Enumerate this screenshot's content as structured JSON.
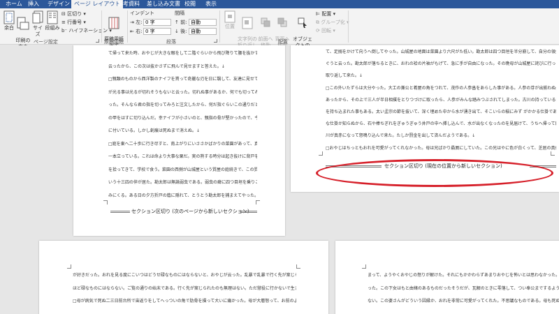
{
  "tabs": [
    "ホーム",
    "挿入",
    "デザイン",
    "ページ レイアウト",
    "参考資料",
    "差し込み文書",
    "校閲",
    "表示"
  ],
  "ribbon": {
    "page_setup": {
      "margins": "余白",
      "orientation": "印刷の\n向き",
      "size": "サイズ",
      "columns": "段組み",
      "breaks": "区切り",
      "line_numbers": "行番号",
      "hyphenation": "ハイフネーション",
      "group_label": "ページ設定"
    },
    "manuscript": {
      "button": "原稿用紙\n設定",
      "group_label": "原稿用紙"
    },
    "paragraph": {
      "indent_heading": "インデント",
      "spacing_heading": "間隔",
      "left_label": "左:",
      "right_label": "右:",
      "left_value": "0 字",
      "right_value": "0 字",
      "before_label": "前:",
      "after_label": "後:",
      "before_value": "自動",
      "after_value": "自動",
      "group_label": "段落"
    },
    "arrange": {
      "position": "位置",
      "wrap_text": "文字列の\n折り返し",
      "bring_forward": "前面へ\n移動",
      "send_backward": "背面へ\n移動",
      "selection_pane": "オブジェクトの\n選択と表示",
      "align": "配置",
      "group": "グループ化",
      "rotate": "回転",
      "group_label": "配置"
    }
  },
  "pages": {
    "left_top_lines": [
      "て帰って来た時、おやじが大きな眼をして二階ぐらいから飛び降りて腰を抜かす奴があるかと",
      "云ったから、この次は抜かさずに飛んで見せますと答えた。↓",
      "□親類のものから西洋製のナイフを貰って奇麗な刃を日に翳して、友達に見せていたら、一人",
      "が光る事は光るが切れそうもないと云った。切れぬ事があるか、何でも切ってみせると受け合",
      "った。そんなら君の指を切ってみろと注文したから、何だ指ぐらいこの通りだと右の手の親指",
      "の甲をはすに切り込んだ。幸ナイフが小さいのと、親指の骨が堅かったので、今だに親指は手",
      "に付いている。しかし創痕は死ぬまで消えぬ。↓",
      "□庭を東へ二十歩に行き尽すと、南上がりにいささかばかりの菜園があって、真中に栗の木が",
      "一本立っている。これは命より大事な栗だ。実の熟する時分は起き抜けに背戸を出て落ちた奴",
      "を拾ってきて、学校で食う。菜園の西側が山城屋という質屋の庭続きで、この質屋に勘太郎と",
      "いう十三四の倅が居た。勘太郎は無論弱虫である。弱虫の癖に四つ目垣を乗りこえて、栗を盗",
      "みにくる。ある日の夕方折戸の蔭に隠れて、とうとう勘太郎を捕まえてやった。その時勘太郎"
    ],
    "left_section_break": "セクション区切り (次のページから新しいセクション)",
    "right_top_lines": [
      "て、足搦をかけて向うへ倒してやった。山城屋の地面は菜園より六尺がた低い。勘太郎は四つ目垣を半分崩して、自分の領分へ真逆様に落ちて",
      "ぐうと云った。勘太郎が落ちるときに、おれの袷の片袖がもげて、急に手が自由になった。その晩母が山城屋に詫びに行ったついでに袷の片袖も",
      "取り返して来た。↓",
      "□この外いたずらは大分やった。大工の兼公と肴屋の角をつれて、茂作の人参畠をあらした事がある。人参の芽が出揃わぬ処へ藁が一面に敷いて",
      "あったから、その上で三人が半日相撲をとりつづけに取ったら、人参がみんな踏みつぶされてしまった。古川の持っている田圃の井戸を埋めて尻",
      "を持ち込まれた事もある。太い孟宗の節を抜いて、深く埋めた中から水が湧き出て、そこいらの稲にみず がかかる仕掛であった。その時分はどん",
      "な仕掛か知らぬから、石や棒ちぎれをぎゅうぎゅう井戸の中へ挿し込んで、水が出なくなったのを見届けて、うちへ帰って飯を食っていたら、古",
      "川が真赤になって怒鳴り込んで来た。たしか罰金を出して済んだようである。↓",
      "□おやじはちっともおれを可愛がってくれなかった。母は兄ばかり贔屓にしていた。この兄はやに色が白くって、芝居の真似をして女形になるの"
    ],
    "right_section_break": "セクション区切り (現在の位置から新しいセクション)",
    "bottom_left_lines": [
      "が好きだった。おれを見る度にこいつはどうせ碌なものにはならないと、おやじが云った。乱暴で乱暴で行く先が案じられると母が云った。なる",
      "ほど碌なものにはならない。ご覧の通りの始末である。行く先が案じられたのも無理はない。ただ懲役に行かないで生きているばかりである。↓",
      "□母が病気で死ぬ二三日前台所で宙返りをしてへっついの角で肋骨を撲って大いに痛かった。母が大層怒って、お前のようなものの顔は見たくな"
    ],
    "bottom_right_lines": [
      "まって、ようやくおやじの怒りが解けた。それにもかかわらずあまりおやじを怖いとは思わなかった。かえってこの清と",
      "った。この下女はもと由緒のあるものだったそうだが、瓦解のときに零落して、つい奉公までするようになったのだと聞いて",
      "ない。この婆さんがどういう因縁か、おれを非常に可愛がってくれた。不思議なものである。母も死ぬ三日前に愛想をつかした"
    ]
  },
  "colors": {
    "tab_bar": "#2b579a",
    "ribbon_bg": "#f3f3f3",
    "doc_bg": "#e6e6e6",
    "annotation": "#d6202a"
  }
}
